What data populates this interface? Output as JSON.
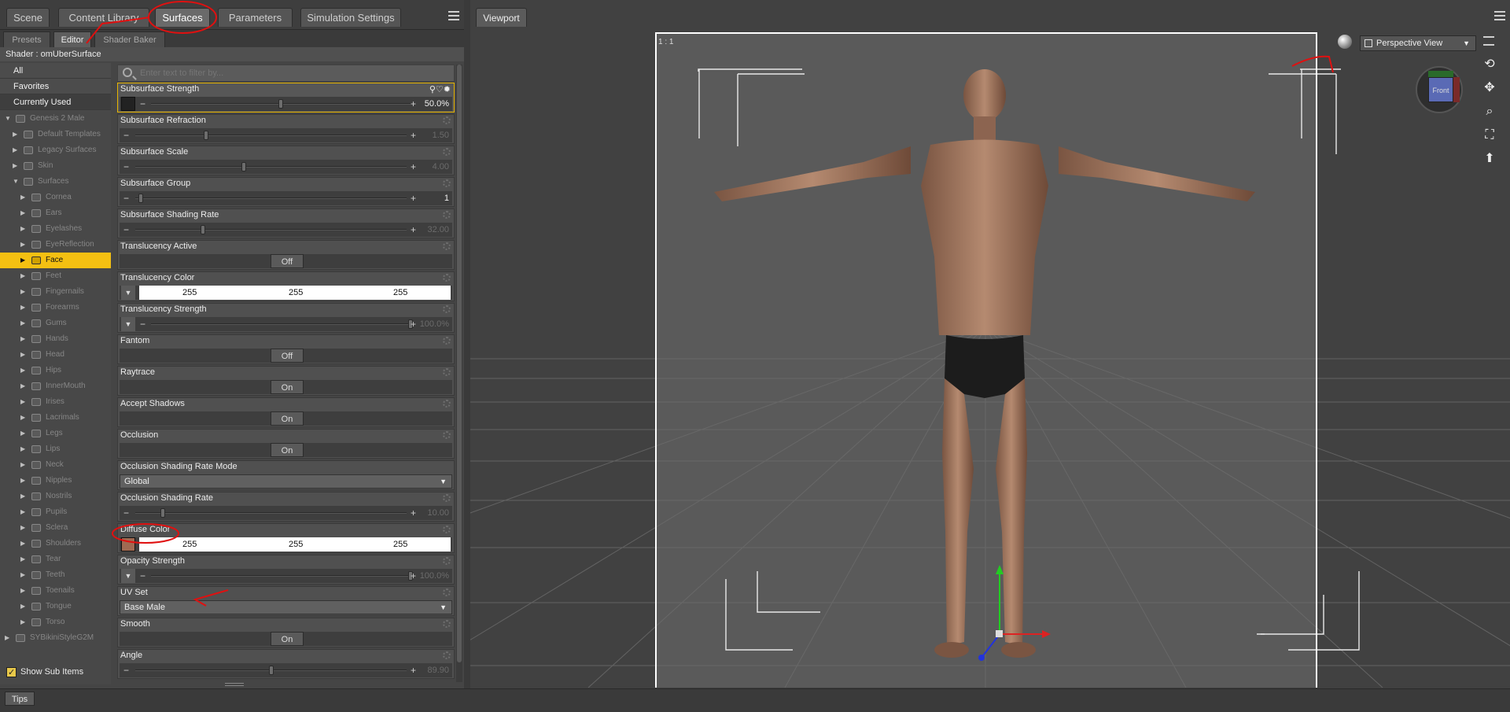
{
  "top_tabs": [
    "Scene",
    "Content Library",
    "Surfaces",
    "Parameters",
    "Simulation Settings"
  ],
  "sub_tabs": [
    "Presets",
    "Editor",
    "Shader Baker"
  ],
  "shader_label": "Shader : omUberSurface",
  "categories": [
    "All",
    "Favorites",
    "Currently Used"
  ],
  "tree": {
    "root": "Genesis 2 Male",
    "groups": [
      "Default Templates",
      "Legacy Surfaces",
      "Skin"
    ],
    "surfaces_label": "Surfaces",
    "surfaces": [
      "Cornea",
      "Ears",
      "Eyelashes",
      "EyeReflection",
      "Face",
      "Feet",
      "Fingernails",
      "Forearms",
      "Gums",
      "Hands",
      "Head",
      "Hips",
      "InnerMouth",
      "Irises",
      "Lacrimals",
      "Legs",
      "Lips",
      "Neck",
      "Nipples",
      "Nostrils",
      "Pupils",
      "Sclera",
      "Shoulders",
      "Tear",
      "Teeth",
      "Toenails",
      "Tongue",
      "Torso"
    ],
    "selected": "Face",
    "other_root": "SYBikiniStyleG2M"
  },
  "show_sub_items": "Show Sub Items",
  "filter_placeholder": "Enter text to filter by...",
  "props": {
    "subsurface_strength": {
      "name": "Subsurface Strength",
      "value": "50.0%",
      "fraction": 0.5
    },
    "subsurface_refraction": {
      "name": "Subsurface Refraction",
      "value": "1.50",
      "fraction": 0.26
    },
    "subsurface_scale": {
      "name": "Subsurface Scale",
      "value": "4.00",
      "fraction": 0.4
    },
    "subsurface_group": {
      "name": "Subsurface Group",
      "value": "1",
      "fraction": 0.02
    },
    "subsurface_shading_rate": {
      "name": "Subsurface Shading Rate",
      "value": "32.00",
      "fraction": 0.25
    },
    "translucency_active": {
      "name": "Translucency Active",
      "value": "Off"
    },
    "translucency_color": {
      "name": "Translucency Color",
      "r": "255",
      "g": "255",
      "b": "255"
    },
    "translucency_strength": {
      "name": "Translucency Strength",
      "value": "100.0%",
      "fraction": 1.0
    },
    "fantom": {
      "name": "Fantom",
      "value": "Off"
    },
    "raytrace": {
      "name": "Raytrace",
      "value": "On"
    },
    "accept_shadows": {
      "name": "Accept Shadows",
      "value": "On"
    },
    "occlusion": {
      "name": "Occlusion",
      "value": "On"
    },
    "occlusion_shading_rate_mode": {
      "name": "Occlusion Shading Rate Mode",
      "value": "Global"
    },
    "occlusion_shading_rate": {
      "name": "Occlusion Shading Rate",
      "value": "10.00",
      "fraction": 0.1
    },
    "diffuse_color": {
      "name": "Diffuse Color",
      "r": "255",
      "g": "255",
      "b": "255"
    },
    "opacity_strength": {
      "name": "Opacity Strength",
      "value": "100.0%",
      "fraction": 1.0
    },
    "uv_set": {
      "name": "UV Set",
      "value": "Base Male"
    },
    "smooth": {
      "name": "Smooth",
      "value": "On"
    },
    "angle": {
      "name": "Angle",
      "value": "89.90",
      "fraction": 0.5
    }
  },
  "tips": "Tips",
  "viewport": {
    "tab": "Viewport",
    "ratio": "1 : 1",
    "view_name": "Perspective View",
    "cube_label": "Front"
  },
  "colors": {
    "selection": "#f4c012",
    "accent_red": "#e01010",
    "skin": "#a06a52"
  }
}
